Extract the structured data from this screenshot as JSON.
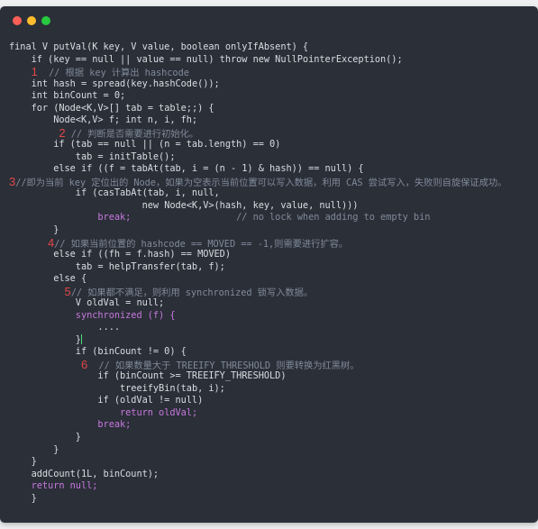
{
  "window": {
    "controls": {
      "close": "#ff5f56",
      "minimize": "#ffbd2e",
      "maximize": "#27c93f"
    }
  },
  "colors": {
    "background": "#2b2f38",
    "keyword": "#c678dd",
    "function": "#e5c07b",
    "comment": "#7f8a99",
    "marker": "#e04848"
  },
  "markers": [
    "1",
    "2",
    "3",
    "4",
    "5",
    "6"
  ],
  "comments": {
    "c1": "// 根据 key 计算出 hashcode",
    "c2": "// 判断是否需要进行初始化。",
    "c3": "//即为当前 key 定位出的 Node，如果为空表示当前位置可以写入数据，利用 CAS 尝试写入，失败则自旋保证成功。",
    "c_nolock": "// no lock when adding to empty bin",
    "c4": "// 如果当前位置的 hashcode == MOVED == -1,则需要进行扩容。",
    "c5": "// 如果都不满足，则利用 synchronized 锁写入数据。",
    "c6": "// 如果数量大于 TREEIFY_THRESHOLD 则要转换为红黑树。"
  },
  "code": {
    "l01": "final V putVal(K key, V value, boolean onlyIfAbsent) {",
    "l02": "if (key == null || value == null) throw new NullPointerException();",
    "l04": "int hash = spread(key.hashCode());",
    "l05": "int binCount = 0;",
    "l06": "for (Node<K,V>[] tab = table;;) {",
    "l07": "Node<K,V> f; int n, i, fh;",
    "l09": "if (tab == null || (n = tab.length) == 0)",
    "l10": "tab = initTable();",
    "l11": "else if ((f = tabAt(tab, i = (n - 1) & hash)) == null) {",
    "l13": "if (casTabAt(tab, i, null,",
    "l14": "new Node<K,V>(hash, key, value, null)))",
    "l15": "break;",
    "l16": "}",
    "l18": "else if ((fh = f.hash) == MOVED)",
    "l19": "tab = helpTransfer(tab, f);",
    "l20": "else {",
    "l22": "V oldVal = null;",
    "l23": "synchronized (f) {",
    "l24": "....",
    "l25": "}",
    "l26": "if (binCount != 0) {",
    "l28": "if (binCount >= TREEIFY_THRESHOLD)",
    "l29": "treeifyBin(tab, i);",
    "l30": "if (oldVal != null)",
    "l31": "return oldVal;",
    "l32": "break;",
    "l33": "}",
    "l34": "}",
    "l35": "}",
    "l36": "addCount(1L, binCount);",
    "l37": "return null;",
    "l38": "}"
  }
}
